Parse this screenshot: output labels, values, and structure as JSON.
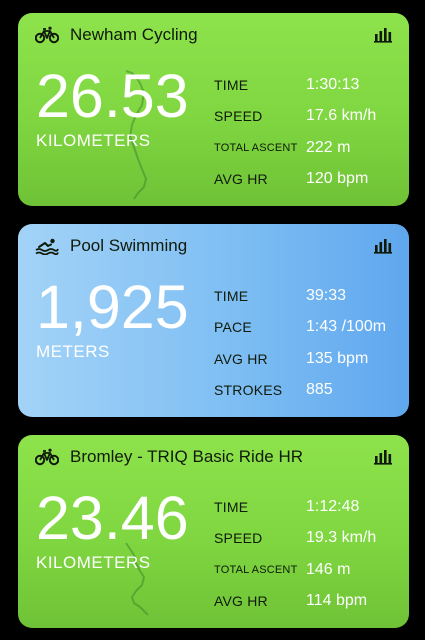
{
  "cards": [
    {
      "title": "Newham Cycling",
      "activity_icon": "bicycle-icon",
      "stats_icon": "bar-chart-icon",
      "big_value": "26.53",
      "big_unit": "KILOMETERS",
      "metrics": [
        {
          "label": "TIME",
          "value": "1:30:13"
        },
        {
          "label": "SPEED",
          "value": "17.6 km/h"
        },
        {
          "label": "TOTAL ASCENT",
          "value": "222 m"
        },
        {
          "label": "AVG HR",
          "value": "120 bpm"
        }
      ]
    },
    {
      "title": "Pool Swimming",
      "activity_icon": "swimmer-icon",
      "stats_icon": "bar-chart-icon",
      "big_value": "1,925",
      "big_unit": "METERS",
      "metrics": [
        {
          "label": "TIME",
          "value": "39:33"
        },
        {
          "label": "PACE",
          "value": "1:43 /100m"
        },
        {
          "label": "AVG HR",
          "value": "135 bpm"
        },
        {
          "label": "STROKES",
          "value": "885"
        }
      ]
    },
    {
      "title": "Bromley - TRIQ Basic Ride HR",
      "activity_icon": "bicycle-icon",
      "stats_icon": "bar-chart-icon",
      "big_value": "23.46",
      "big_unit": "KILOMETERS",
      "metrics": [
        {
          "label": "TIME",
          "value": "1:12:48"
        },
        {
          "label": "SPEED",
          "value": "19.3 km/h"
        },
        {
          "label": "TOTAL ASCENT",
          "value": "146 m"
        },
        {
          "label": "AVG HR",
          "value": "114 bpm"
        }
      ]
    }
  ],
  "colors": {
    "background": "#000000",
    "cycling_card": "#7fd640",
    "swim_card": "#7ebef3",
    "value_text": "#ffffff",
    "label_text": "#101a0a",
    "route_line": "#3f8a2e"
  }
}
